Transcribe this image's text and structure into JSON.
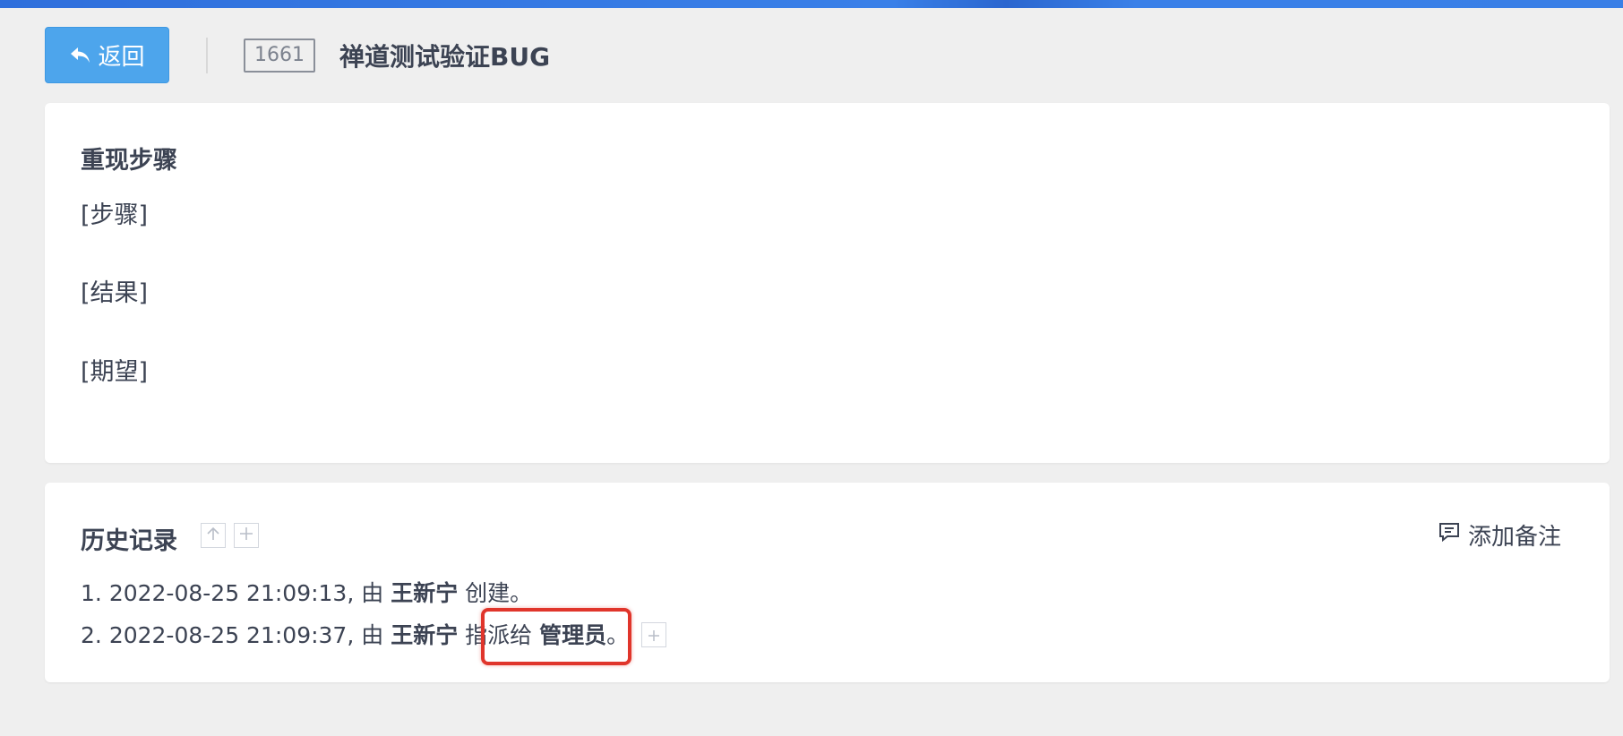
{
  "header": {
    "back_label": "返回",
    "bug_id": "1661",
    "bug_title": "禅道测试验证BUG"
  },
  "steps_section": {
    "title": "重现步骤",
    "lines": [
      "[步骤]",
      "[结果]",
      "[期望]"
    ]
  },
  "history": {
    "title": "历史记录",
    "add_note_label": "添加备注",
    "entries": [
      {
        "index": "1.",
        "datetime": "2022-08-25 21:09:13,",
        "by": "由",
        "user": "王新宁",
        "action": "创建。"
      },
      {
        "index": "2.",
        "datetime": "2022-08-25 21:09:37,",
        "by": "由",
        "user": "王新宁",
        "action": "指派给",
        "target": "管理员",
        "end": "。"
      }
    ]
  },
  "icons": {
    "back": "reply-arrow-icon",
    "sort": "arrow-up-icon",
    "expand": "plus-icon",
    "note": "comment-icon"
  },
  "colors": {
    "accent": "#4da5ec",
    "highlight": "#e0352b",
    "top_bar": "#3a80e8"
  }
}
